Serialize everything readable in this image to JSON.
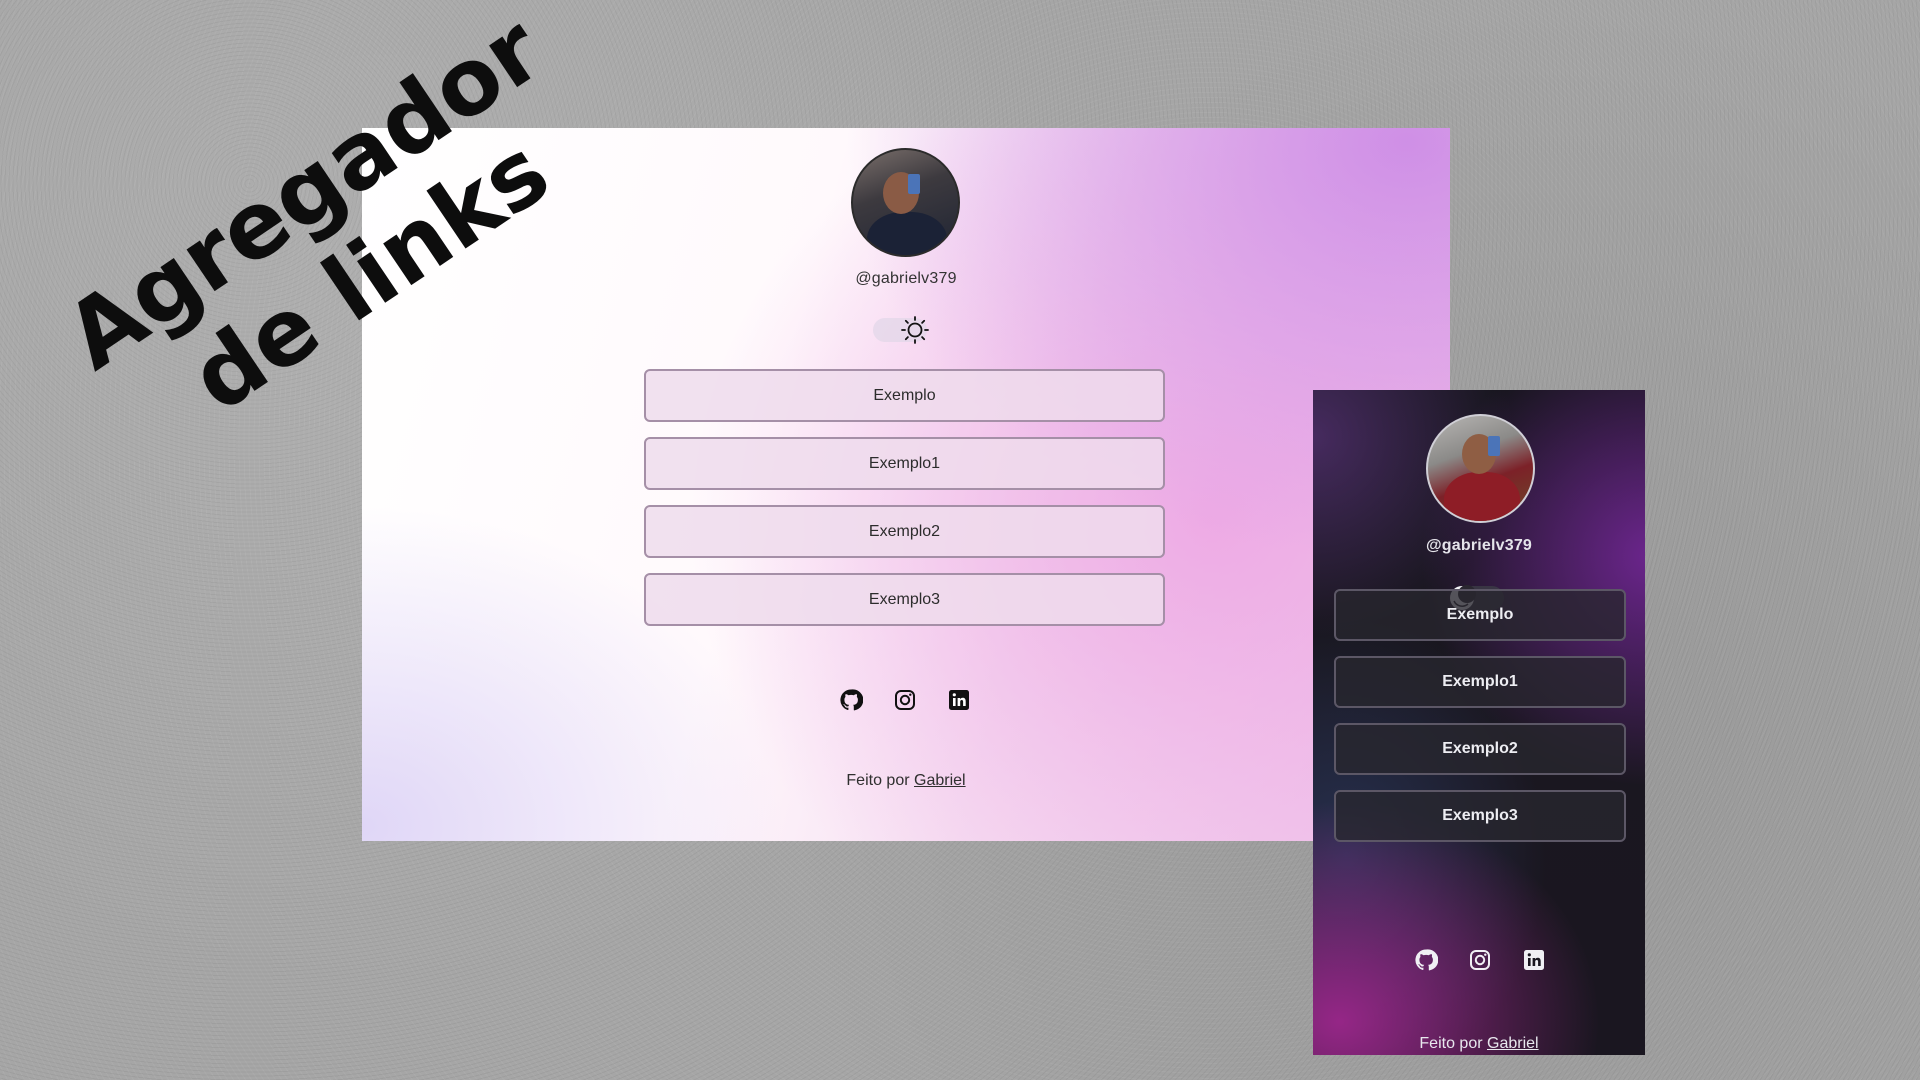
{
  "banner": {
    "title_line1": "Agregador",
    "title_line2": "de links"
  },
  "light_page": {
    "theme": "light",
    "username": "@gabrielv379",
    "toggle_icon": "sun-icon",
    "links": [
      {
        "label": "Exemplo"
      },
      {
        "label": "Exemplo1"
      },
      {
        "label": "Exemplo2"
      },
      {
        "label": "Exemplo3"
      }
    ],
    "socials": [
      "github-icon",
      "instagram-icon",
      "linkedin-icon"
    ],
    "footer_prefix": "Feito por",
    "footer_link": "Gabriel",
    "colors": {
      "accent": "#e6a6e6",
      "button_border": "#a58fa7",
      "text": "#2c2c2c"
    }
  },
  "dark_page": {
    "theme": "dark",
    "username": "@gabrielv379",
    "toggle_icon": "moon-icon",
    "links": [
      {
        "label": "Exemplo"
      },
      {
        "label": "Exemplo1"
      },
      {
        "label": "Exemplo2"
      },
      {
        "label": "Exemplo3"
      }
    ],
    "socials": [
      "github-icon",
      "instagram-icon",
      "linkedin-icon"
    ],
    "footer_prefix": "Feito por",
    "footer_link": "Gabriel",
    "colors": {
      "accent": "#7a28a0",
      "button_border": "#5c5766",
      "text": "#ededf2"
    }
  }
}
